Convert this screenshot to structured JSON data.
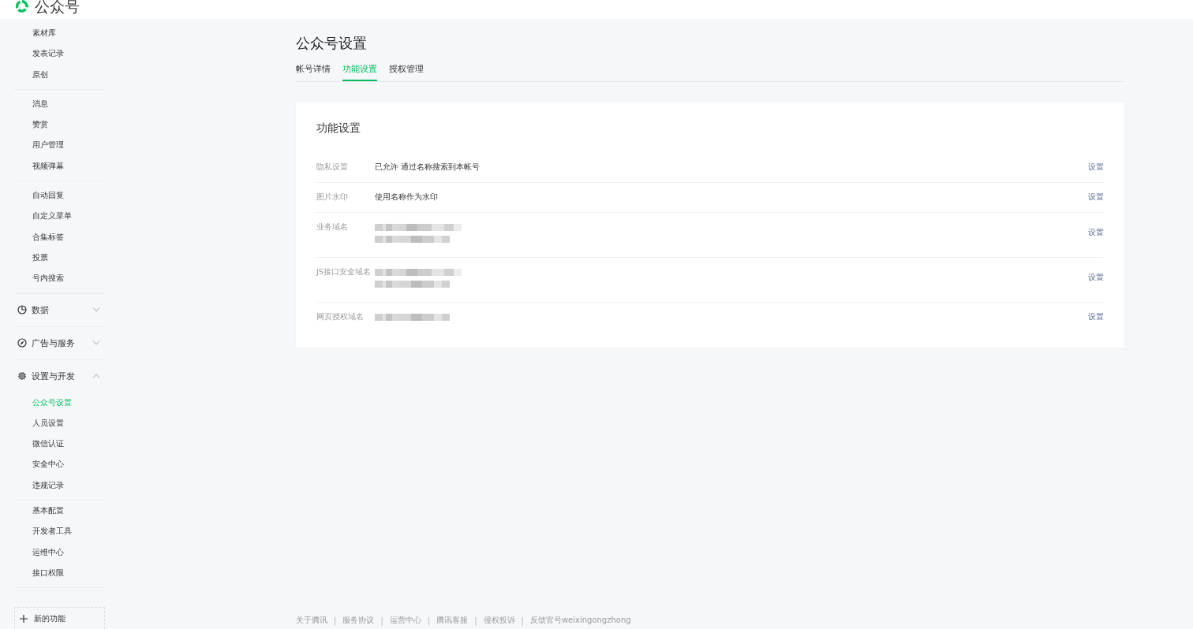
{
  "header": {
    "logo_text": "公众号"
  },
  "sidebar": {
    "groups": [
      {
        "items": [
          {
            "label": "素材库",
            "selected": false
          },
          {
            "label": "发表记录",
            "selected": false
          },
          {
            "label": "原创",
            "selected": false
          }
        ]
      },
      {
        "items": [
          {
            "label": "消息",
            "selected": false
          },
          {
            "label": "赞赏",
            "selected": false
          },
          {
            "label": "用户管理",
            "selected": false
          },
          {
            "label": "视频弹幕",
            "selected": false
          }
        ]
      },
      {
        "items": [
          {
            "label": "自动回复",
            "selected": false
          },
          {
            "label": "自定义菜单",
            "selected": false
          },
          {
            "label": "合集标签",
            "selected": false
          },
          {
            "label": "投票",
            "selected": false
          },
          {
            "label": "号内搜索",
            "selected": false
          }
        ]
      }
    ],
    "sections": [
      {
        "title": "数据",
        "kind": "chart",
        "expanded": false
      },
      {
        "title": "广告与服务",
        "kind": "compass",
        "expanded": false
      },
      {
        "title": "设置与开发",
        "kind": "gear",
        "expanded": true,
        "groups": [
          {
            "items": [
              {
                "label": "公众号设置",
                "selected": true
              },
              {
                "label": "人员设置",
                "selected": false
              },
              {
                "label": "微信认证",
                "selected": false
              },
              {
                "label": "安全中心",
                "selected": false
              },
              {
                "label": "违规记录",
                "selected": false
              }
            ]
          },
          {
            "items": [
              {
                "label": "基本配置",
                "selected": false
              },
              {
                "label": "开发者工具",
                "selected": false
              },
              {
                "label": "运维中心",
                "selected": false
              },
              {
                "label": "接口权限",
                "selected": false
              }
            ]
          }
        ]
      }
    ],
    "new_feature_button": "新的功能"
  },
  "page": {
    "title": "公众号设置",
    "tabs": [
      {
        "label": "帐号详情",
        "selected": false
      },
      {
        "label": "功能设置",
        "selected": true
      },
      {
        "label": "授权管理",
        "selected": false
      }
    ],
    "card": {
      "title": "功能设置",
      "rows": [
        {
          "label": "隐私设置",
          "kind": "text",
          "value": "已允许 通过名称搜索到本帐号",
          "action": "设置"
        },
        {
          "label": "图片水印",
          "kind": "text",
          "value": "使用名称作为水印",
          "action": "设置"
        },
        {
          "label": "业务域名",
          "kind": "redacted",
          "redacted": [
            {
              "kind": "long"
            },
            {
              "kind": "short"
            }
          ],
          "action": "设置"
        },
        {
          "label": "JS接口安全域名",
          "kind": "redacted",
          "redacted": [
            {
              "kind": "long"
            },
            {
              "kind": "short"
            }
          ],
          "action": "设置"
        },
        {
          "label": "网页授权域名",
          "kind": "redacted",
          "redacted": [
            {
              "kind": "short"
            }
          ],
          "action": "设置"
        }
      ]
    }
  },
  "footer": {
    "links": [
      "关于腾讯",
      "服务协议",
      "运营中心",
      "腾讯客服",
      "侵权投诉",
      "反馈官号weixingongzhong"
    ],
    "separator": "|"
  }
}
